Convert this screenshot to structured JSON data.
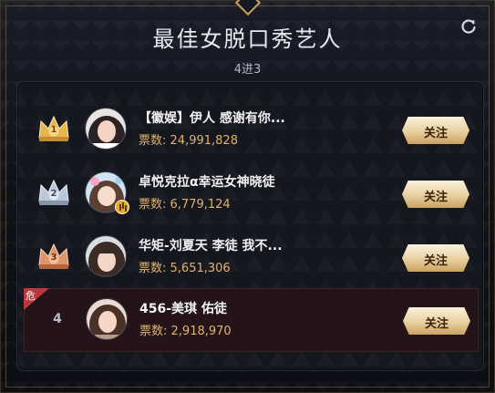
{
  "header": {
    "title": "最佳女脱口秀艺人",
    "subtitle": "4进3",
    "refresh_icon": "refresh-icon"
  },
  "colors": {
    "gold": "#e0b36a",
    "danger": "#b8383d",
    "button": "#e8cf9f"
  },
  "list": {
    "votes_label": "票数:",
    "follow_label": "关注",
    "danger_label": "危",
    "rows": [
      {
        "rank": "1",
        "name": "【徽娱】伊人 感谢有你...",
        "votes": "24,991,828",
        "medal": "gold-crown-icon"
      },
      {
        "rank": "2",
        "name": "卓悦克拉α幸运女神晓徒",
        "votes": "6,779,124",
        "medal": "silver-crown-icon"
      },
      {
        "rank": "3",
        "name": "华矩-刘夏天 李徒 我不...",
        "votes": "5,651,306",
        "medal": "bronze-crown-icon"
      },
      {
        "rank": "4",
        "name": "456-美琪 佑徒",
        "votes": "2,918,970",
        "medal": ""
      }
    ]
  }
}
